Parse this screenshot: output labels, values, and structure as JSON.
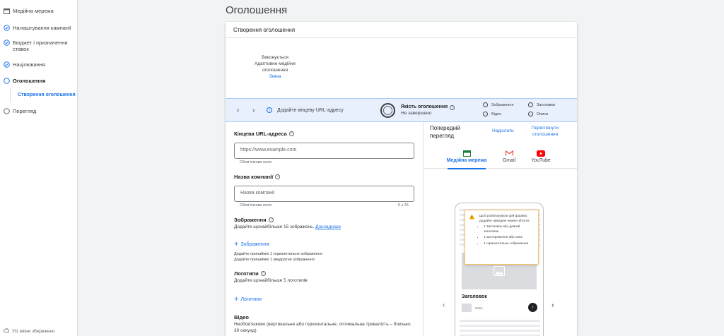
{
  "sidebar": {
    "items": [
      {
        "label": "Медійна мережа",
        "icon": "display-network-icon",
        "state": "plain"
      },
      {
        "label": "Налаштування кампанії",
        "icon": "check-circle-icon",
        "state": "done"
      },
      {
        "label": "Бюджет і призначення ставок",
        "icon": "check-circle-icon",
        "state": "done"
      },
      {
        "label": "Націлювання",
        "icon": "check-circle-icon",
        "state": "done"
      },
      {
        "label": "Оголошення",
        "icon": "circle-icon",
        "state": "active"
      },
      {
        "label": "Перегляд",
        "icon": "circle-icon",
        "state": "todo"
      }
    ],
    "sub_item": "Створення оголошення",
    "footer": "Усі зміни збережено"
  },
  "page": {
    "title": "Оголошення"
  },
  "card": {
    "title": "Створення оголошення",
    "ad_type": {
      "line1": "Виконується",
      "line2": "Адаптивне медійне оголошення",
      "change_link": "Зміна"
    }
  },
  "quality": {
    "hint": "Додайте кінцеву URL-адресу",
    "title": "Якість оголошення",
    "status": "Не завершено",
    "checks": [
      "Зображення",
      "Заголовки",
      "Відео",
      "Описи"
    ]
  },
  "form": {
    "url": {
      "label": "Кінцева URL-адреса",
      "placeholder": "https://www.example.com",
      "note": "Обов’язкове поле"
    },
    "company": {
      "label": "Назва компанії",
      "placeholder": "Назва компанії",
      "note": "Обов’язкове поле",
      "counter": "0 з 25"
    },
    "images": {
      "label": "Зображення",
      "desc": "Додайте щонайбільше 15 зображень.",
      "more_link": "Докладніше",
      "add": "Зображення",
      "req1": "Додайте принаймні 1 горизонтальне зображення",
      "req2": "Додайте принаймні 1 квадратне зображення"
    },
    "logos": {
      "label": "Логотипи",
      "desc": "Додайте щонайбільше 5 логотипів",
      "add": "Логотипи"
    },
    "video": {
      "label": "Відео",
      "desc": "Необов’язково (вертикальне або горизонтальне, оптимальна тривалість – близько 30 секунд)"
    }
  },
  "preview": {
    "title": "Попередній перегляд",
    "shared_link": "Надіслати",
    "view_previews_link": "Переглянути оголошення",
    "tabs": [
      {
        "label": "Медійна мережа",
        "icon": "display-network-icon"
      },
      {
        "label": "Gmail",
        "icon": "gmail-icon"
      },
      {
        "label": "YouTube",
        "icon": "youtube-icon"
      }
    ],
    "active_tab": "Медійна мережа",
    "warning": {
      "intro": "Щоб розблокувати цей формат, додайте наведені нижче об’єкти:",
      "items": [
        "1 Заголовок або довгий заголовок",
        "1 застереження або опис",
        "1 горизонтальне зображення"
      ]
    },
    "ad_headline": "Заголовок",
    "ad_desc": "Опис"
  },
  "colors": {
    "accent": "#1a73e8",
    "quality_bg": "#e8f0fe",
    "warning": "#f4b400"
  }
}
